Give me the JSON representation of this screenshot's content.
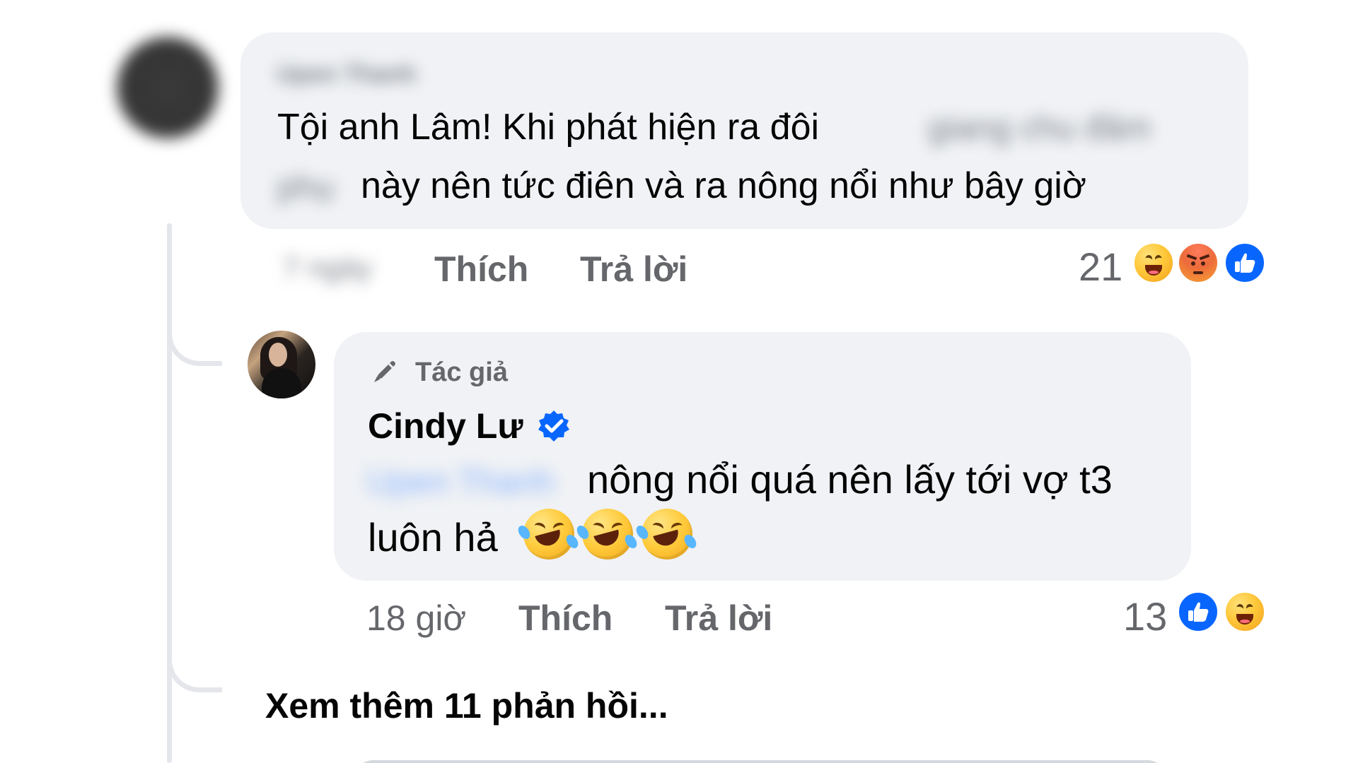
{
  "thread": {
    "main_comment": {
      "author_name": "Upen Thanh",
      "text_line_1": "Tội anh Lâm! Khi phát hiện ra đôi",
      "text_line_1_hidden": "giang chu đảm",
      "text_line_2_hidden": "phụ",
      "text_line_2": "này nên tức điên và ra nông nổi như bây giờ",
      "time": "7 ngày",
      "like_label": "Thích",
      "reply_label": "Trả lời",
      "reaction_count": "21",
      "reactions": [
        "haha",
        "angry",
        "like"
      ]
    },
    "reply_comment": {
      "author_badge": "Tác giả",
      "author_name": "Cindy Lư",
      "mention": "Upen Thanh",
      "text_line_1": "nông nổi quá nên lấy tới vợ t3",
      "text_line_2": "luôn hả",
      "emoji_count": 3,
      "time": "18 giờ",
      "like_label": "Thích",
      "reply_label": "Trả lời",
      "reaction_count": "13",
      "reactions": [
        "like",
        "haha"
      ]
    },
    "more_replies_label": "Xem thêm 11 phản hồi..."
  },
  "colors": {
    "bubble": "#f0f2f5",
    "meta": "#65676b",
    "text": "#050505",
    "verified": "#0866ff",
    "thread_line": "#e4e6eb"
  },
  "icons": {
    "author_badge": "pen-icon",
    "verified": "verified-badge-icon",
    "reaction_like": "like-reaction-icon",
    "reaction_haha": "haha-reaction-icon",
    "reaction_angry": "angry-reaction-icon",
    "inline_emoji": "rolling-on-floor-laughing-emoji"
  }
}
